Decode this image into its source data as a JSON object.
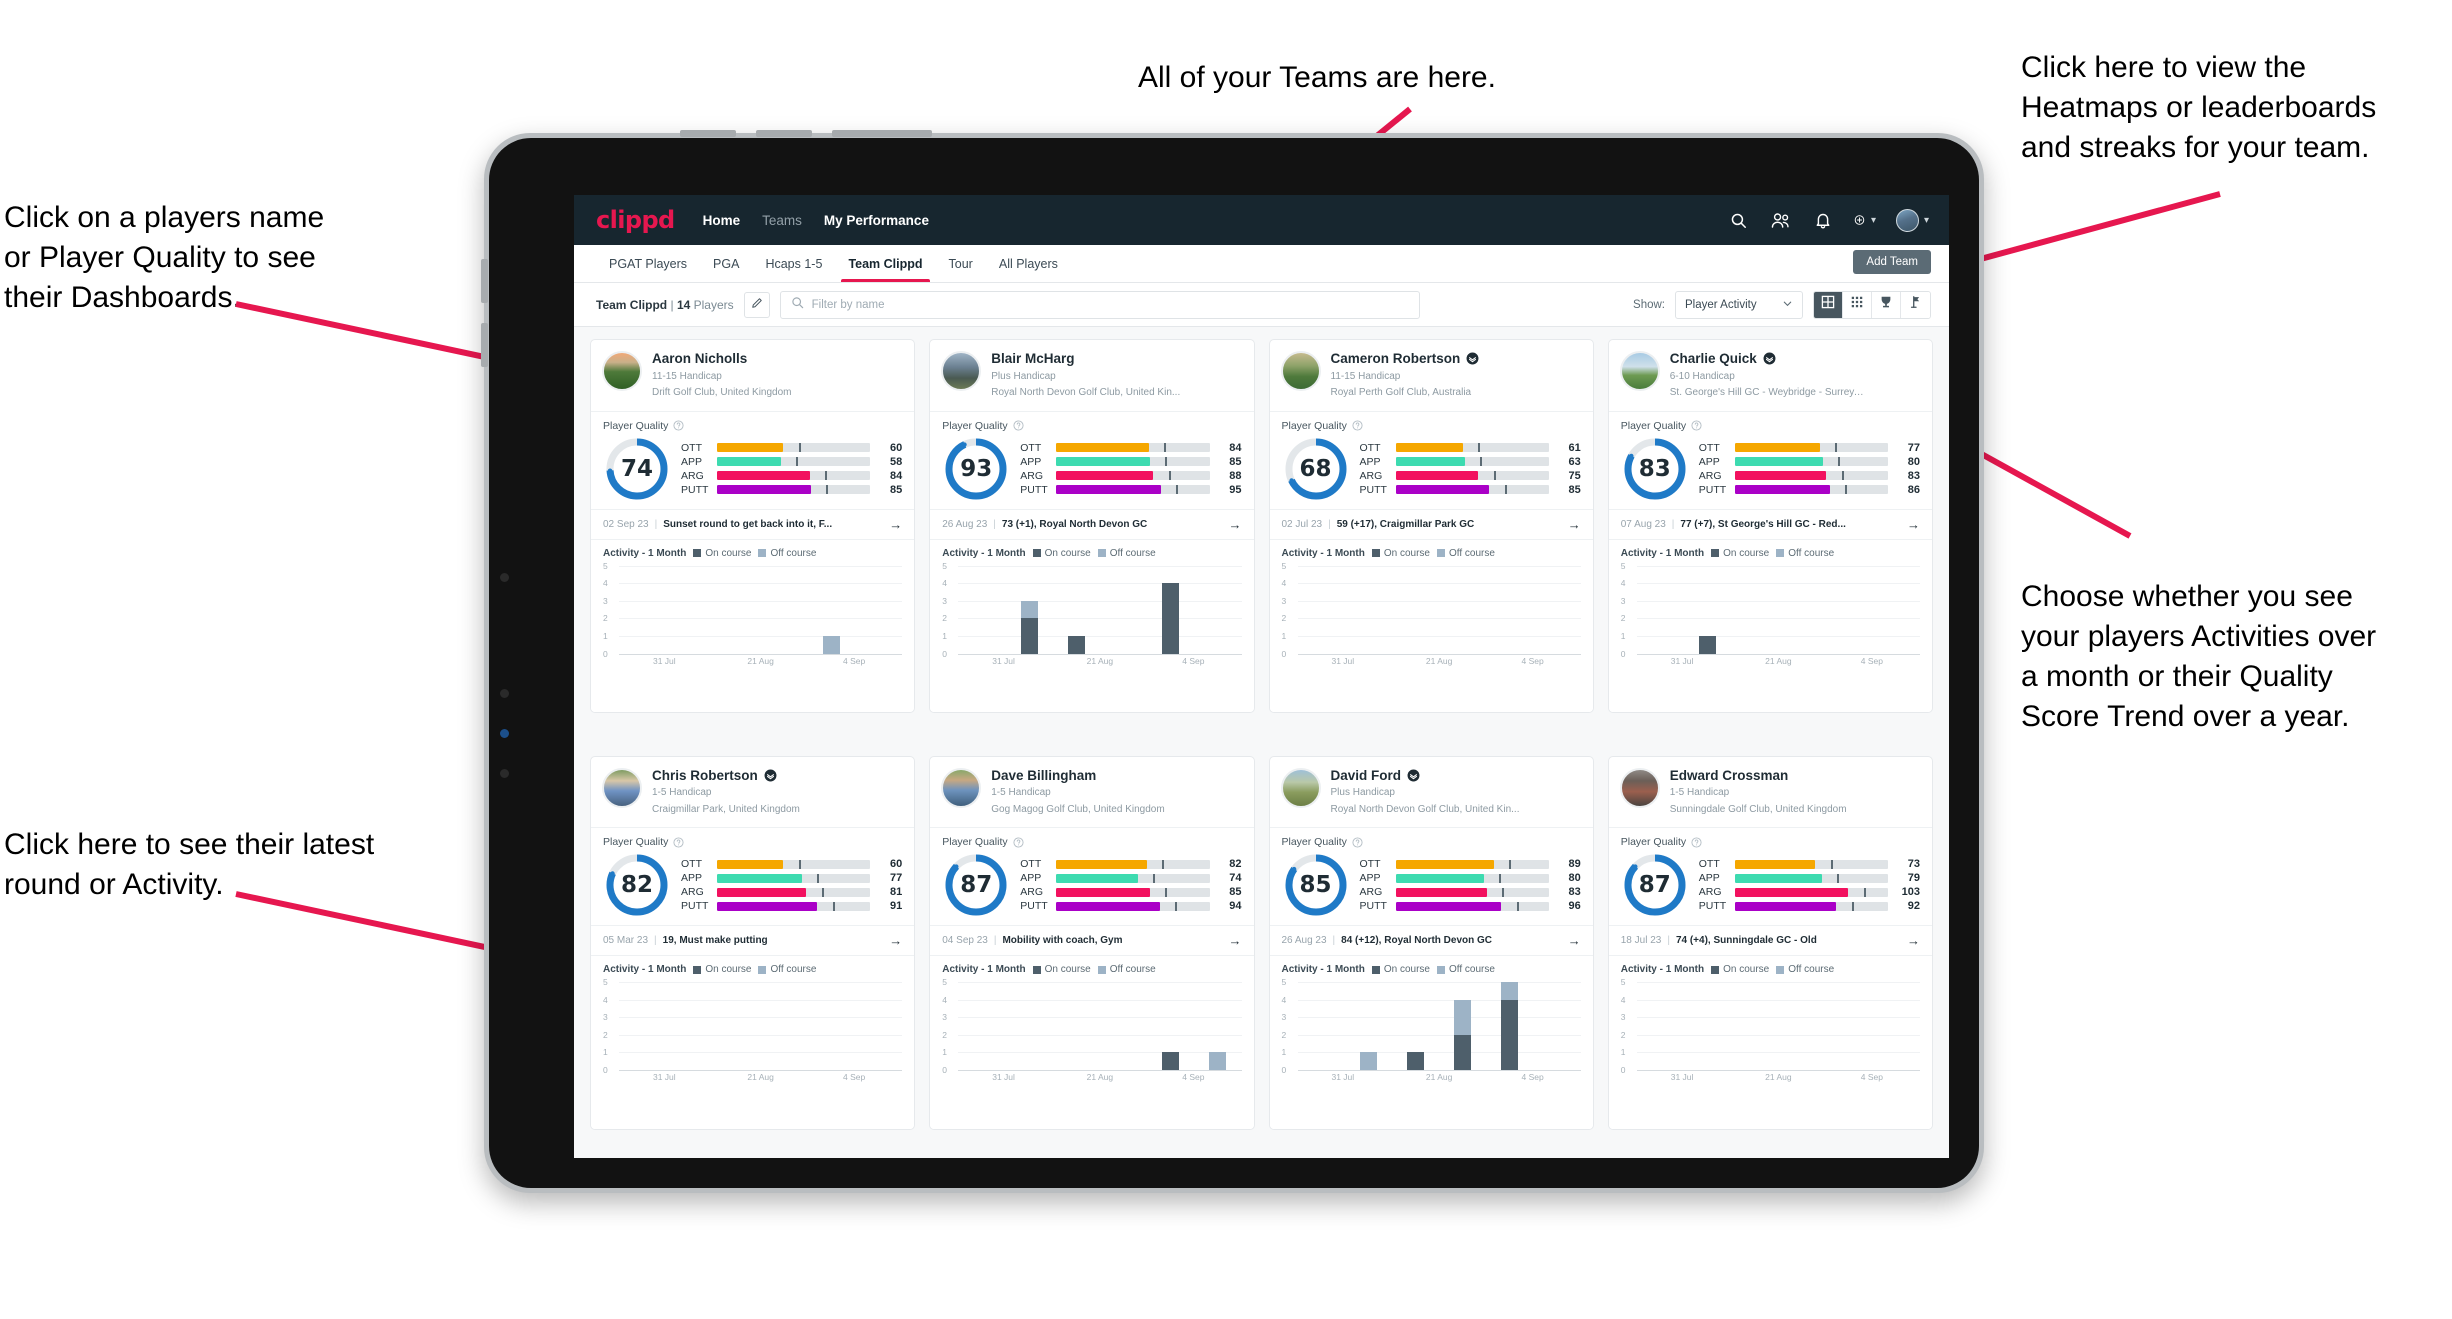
{
  "annotations": [
    {
      "id": "teams",
      "text": "All of your Teams are here."
    },
    {
      "id": "heatmaps",
      "text": "Click here to view the\nHeatmaps or leaderboards\nand streaks for your team."
    },
    {
      "id": "player-name",
      "text": "Click on a players name\nor Player Quality to see\ntheir Dashboards."
    },
    {
      "id": "activity-choice",
      "text": "Choose whether you see\nyour players Activities over\na month or their Quality\nScore Trend over a year."
    },
    {
      "id": "latest-round",
      "text": "Click here to see their latest\nround or Activity."
    }
  ],
  "app": {
    "brand": "clippd",
    "nav": [
      {
        "label": "Home",
        "active": true
      },
      {
        "label": "Teams",
        "active": false
      },
      {
        "label": "My Performance",
        "active": true
      }
    ],
    "header_icons": [
      "search-icon",
      "people-icon",
      "bell-icon",
      "plus-circle-icon",
      "avatar"
    ],
    "tabs": [
      {
        "label": "PGAT Players",
        "active": false
      },
      {
        "label": "PGA",
        "active": false
      },
      {
        "label": "Hcaps 1-5",
        "active": false
      },
      {
        "label": "Team Clippd",
        "active": true
      },
      {
        "label": "Tour",
        "active": false
      },
      {
        "label": "All Players",
        "active": false
      }
    ],
    "add_team_label": "Add Team",
    "toolbar": {
      "team_name": "Team Clippd",
      "separator": "|",
      "player_count": "14",
      "players_word": "Players",
      "edit_icon": "pencil-icon",
      "search_placeholder": "Filter by name",
      "search_value": "",
      "show_label": "Show:",
      "show_value": "Player Activity",
      "show_options": [
        "Player Activity",
        "Quality Score Trend"
      ],
      "views": [
        {
          "name": "cards-view",
          "icon": "grid-large-icon",
          "active": true
        },
        {
          "name": "table-view",
          "icon": "grid-dense-icon",
          "active": false
        },
        {
          "name": "leaderboard-view",
          "icon": "trophy-icon",
          "active": false
        },
        {
          "name": "heatmap-view",
          "icon": "flag-icon",
          "active": false
        }
      ]
    },
    "card_labels": {
      "player_quality": "Player Quality",
      "activity": "Activity - 1 Month",
      "legend_on": "On course",
      "legend_off": "Off course",
      "skills": [
        "OTT",
        "APP",
        "ARG",
        "PUTT"
      ]
    },
    "colors": {
      "brand_pink": "#e6174f",
      "appbar": "#17262f",
      "ott": "#f5a700",
      "app": "#3ddbb0",
      "arg": "#f2115f",
      "putt": "#aa00c7",
      "ring": "#1f7ac7",
      "on_course": "#4e5f6b",
      "off_course": "#9db3c6"
    },
    "chart_axis": {
      "y_ticks": [
        5,
        4,
        3,
        2,
        1,
        0
      ],
      "x_ticks": [
        "31 Jul",
        "21 Aug",
        "4 Sep"
      ],
      "ymax": 5
    }
  },
  "players": [
    {
      "name": "Aaron Nicholls",
      "verified": false,
      "handicap": "11-15 Handicap",
      "club": "Drift Golf Club, United Kingdom",
      "quality": 74,
      "skills": [
        {
          "label": "OTT",
          "value": 60
        },
        {
          "label": "APP",
          "value": 58
        },
        {
          "label": "ARG",
          "value": 84
        },
        {
          "label": "PUTT",
          "value": 85
        }
      ],
      "latest_date": "02 Sep 23",
      "latest_desc": "Sunset round to get back into it, F...",
      "activity": [
        {
          "on": 0,
          "off": 0
        },
        {
          "on": 0,
          "off": 0
        },
        {
          "on": 0,
          "off": 0
        },
        {
          "on": 0,
          "off": 0
        },
        {
          "on": 0,
          "off": 1
        },
        {
          "on": 0,
          "off": 0
        }
      ],
      "avatar_css": "linear-gradient(180deg,#f0a978 0%,#c9b08a 26%,#4e7a3a 52%,#2f5f25 100%)"
    },
    {
      "name": "Blair McHarg",
      "verified": false,
      "handicap": "Plus Handicap",
      "club": "Royal North Devon Golf Club, United Kin...",
      "quality": 93,
      "skills": [
        {
          "label": "OTT",
          "value": 84
        },
        {
          "label": "APP",
          "value": 85
        },
        {
          "label": "ARG",
          "value": 88
        },
        {
          "label": "PUTT",
          "value": 95
        }
      ],
      "latest_date": "26 Aug 23",
      "latest_desc": "73 (+1), Royal North Devon GC",
      "activity": [
        {
          "on": 0,
          "off": 0
        },
        {
          "on": 2,
          "off": 1
        },
        {
          "on": 1,
          "off": 0
        },
        {
          "on": 0,
          "off": 0
        },
        {
          "on": 4,
          "off": 0
        },
        {
          "on": 0,
          "off": 0
        }
      ],
      "avatar_css": "linear-gradient(180deg,#9fb4c6 0%,#6a7f90 40%,#4a5a52 70%,#6b7a55 100%)"
    },
    {
      "name": "Cameron Robertson",
      "verified": true,
      "handicap": "11-15 Handicap",
      "club": "Royal Perth Golf Club, Australia",
      "quality": 68,
      "skills": [
        {
          "label": "OTT",
          "value": 61
        },
        {
          "label": "APP",
          "value": 63
        },
        {
          "label": "ARG",
          "value": 75
        },
        {
          "label": "PUTT",
          "value": 85
        }
      ],
      "latest_date": "02 Jul 23",
      "latest_desc": "59 (+17), Craigmillar Park GC",
      "activity": [
        {
          "on": 0,
          "off": 0
        },
        {
          "on": 0,
          "off": 0
        },
        {
          "on": 0,
          "off": 0
        },
        {
          "on": 0,
          "off": 0
        },
        {
          "on": 0,
          "off": 0
        },
        {
          "on": 0,
          "off": 0
        }
      ],
      "avatar_css": "linear-gradient(180deg,#c6bb8e 0%,#8fa36a 35%,#4f7a3c 65%,#3c6b34 100%)"
    },
    {
      "name": "Charlie Quick",
      "verified": true,
      "handicap": "6-10 Handicap",
      "club": "St. George's Hill GC - Weybridge - Surrey, ...",
      "quality": 83,
      "skills": [
        {
          "label": "OTT",
          "value": 77
        },
        {
          "label": "APP",
          "value": 80
        },
        {
          "label": "ARG",
          "value": 83
        },
        {
          "label": "PUTT",
          "value": 86
        }
      ],
      "latest_date": "07 Aug 23",
      "latest_desc": "77 (+7), St George's Hill GC - Red...",
      "activity": [
        {
          "on": 0,
          "off": 0
        },
        {
          "on": 1,
          "off": 0
        },
        {
          "on": 0,
          "off": 0
        },
        {
          "on": 0,
          "off": 0
        },
        {
          "on": 0,
          "off": 0
        },
        {
          "on": 0,
          "off": 0
        }
      ],
      "avatar_css": "linear-gradient(180deg,#a8cbe4 0%,#cfe0ea 38%,#6d9a52 62%,#4a7d3c 100%)"
    },
    {
      "name": "Chris Robertson",
      "verified": true,
      "handicap": "1-5 Handicap",
      "club": "Craigmillar Park, United Kingdom",
      "quality": 82,
      "skills": [
        {
          "label": "OTT",
          "value": 60
        },
        {
          "label": "APP",
          "value": 77
        },
        {
          "label": "ARG",
          "value": 81
        },
        {
          "label": "PUTT",
          "value": 91
        }
      ],
      "latest_date": "05 Mar 23",
      "latest_desc": "19, Must make putting",
      "activity": [
        {
          "on": 0,
          "off": 0
        },
        {
          "on": 0,
          "off": 0
        },
        {
          "on": 0,
          "off": 0
        },
        {
          "on": 0,
          "off": 0
        },
        {
          "on": 0,
          "off": 0
        },
        {
          "on": 0,
          "off": 0
        }
      ],
      "avatar_css": "linear-gradient(180deg,#7f9c63 0%,#d8c7a8 30%,#6f93c4 58%,#47617f 100%)"
    },
    {
      "name": "Dave Billingham",
      "verified": false,
      "handicap": "1-5 Handicap",
      "club": "Gog Magog Golf Club, United Kingdom",
      "quality": 87,
      "skills": [
        {
          "label": "OTT",
          "value": 82
        },
        {
          "label": "APP",
          "value": 74
        },
        {
          "label": "ARG",
          "value": 85
        },
        {
          "label": "PUTT",
          "value": 94
        }
      ],
      "latest_date": "04 Sep 23",
      "latest_desc": "Mobility with coach, Gym",
      "activity": [
        {
          "on": 0,
          "off": 0
        },
        {
          "on": 0,
          "off": 0
        },
        {
          "on": 0,
          "off": 0
        },
        {
          "on": 0,
          "off": 0
        },
        {
          "on": 1,
          "off": 0
        },
        {
          "on": 0,
          "off": 1
        }
      ],
      "avatar_css": "linear-gradient(180deg,#89a86b 0%,#c8a882 28%,#6e93bd 56%,#3f5f7d 100%)"
    },
    {
      "name": "David Ford",
      "verified": true,
      "handicap": "Plus Handicap",
      "club": "Royal North Devon Golf Club, United Kin...",
      "quality": 85,
      "skills": [
        {
          "label": "OTT",
          "value": 89
        },
        {
          "label": "APP",
          "value": 80
        },
        {
          "label": "ARG",
          "value": 83
        },
        {
          "label": "PUTT",
          "value": 96
        }
      ],
      "latest_date": "26 Aug 23",
      "latest_desc": "84 (+12), Royal North Devon GC",
      "activity": [
        {
          "on": 0,
          "off": 0
        },
        {
          "on": 0,
          "off": 1
        },
        {
          "on": 1,
          "off": 0
        },
        {
          "on": 2,
          "off": 2
        },
        {
          "on": 4,
          "off": 1
        },
        {
          "on": 0,
          "off": 0
        }
      ],
      "avatar_css": "linear-gradient(180deg,#9fc0d8 0%,#b9c8a8 34%,#8a9c5e 62%,#6c7f45 100%)"
    },
    {
      "name": "Edward Crossman",
      "verified": false,
      "handicap": "1-5 Handicap",
      "club": "Sunningdale Golf Club, United Kingdom",
      "quality": 87,
      "skills": [
        {
          "label": "OTT",
          "value": 73
        },
        {
          "label": "APP",
          "value": 79
        },
        {
          "label": "ARG",
          "value": 103
        },
        {
          "label": "PUTT",
          "value": 92
        }
      ],
      "latest_date": "18 Jul 23",
      "latest_desc": "74 (+4), Sunningdale GC - Old",
      "activity": [
        {
          "on": 0,
          "off": 0
        },
        {
          "on": 0,
          "off": 0
        },
        {
          "on": 0,
          "off": 0
        },
        {
          "on": 0,
          "off": 0
        },
        {
          "on": 0,
          "off": 0
        },
        {
          "on": 0,
          "off": 0
        }
      ],
      "avatar_css": "linear-gradient(180deg,#8f8a86 0%,#6b5f58 30%,#9b5f4e 60%,#4a4440 100%)"
    }
  ]
}
